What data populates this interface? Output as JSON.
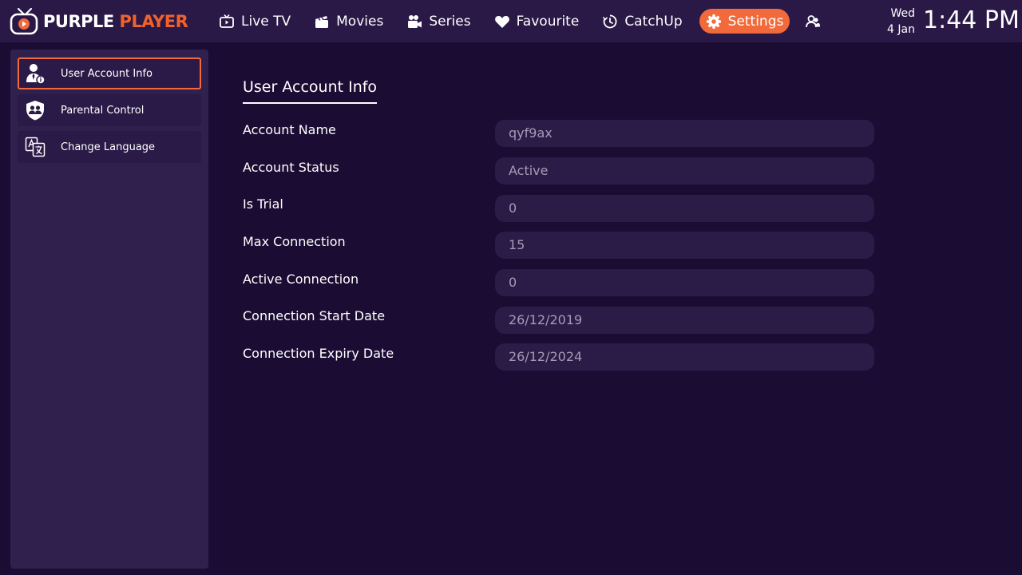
{
  "app": {
    "logo_main": "PURPLE",
    "logo_accent": "PLAYER"
  },
  "nav": {
    "items": [
      {
        "label": "Live TV",
        "icon": "tv-icon"
      },
      {
        "label": "Movies",
        "icon": "clapperboard-icon"
      },
      {
        "label": "Series",
        "icon": "video-camera-icon"
      },
      {
        "label": "Favourite",
        "icon": "heart-icon"
      },
      {
        "label": "CatchUp",
        "icon": "clock-history-icon"
      },
      {
        "label": "Settings",
        "icon": "gear-icon",
        "active": true
      }
    ],
    "profile_icon": "users-icon"
  },
  "datetime": {
    "day": "Wed",
    "date": "4 Jan",
    "time": "1:44 PM"
  },
  "sidebar": {
    "items": [
      {
        "label": "User Account Info",
        "icon": "user-info-icon",
        "active": true
      },
      {
        "label": "Parental Control",
        "icon": "shield-users-icon"
      },
      {
        "label": "Change Language",
        "icon": "translate-icon"
      }
    ]
  },
  "main": {
    "title": "User Account Info",
    "rows": [
      {
        "label": "Account Name",
        "value": "qyf9ax"
      },
      {
        "label": "Account Status",
        "value": "Active"
      },
      {
        "label": "Is Trial",
        "value": "0"
      },
      {
        "label": "Max Connection",
        "value": "15"
      },
      {
        "label": "Active Connection",
        "value": "0"
      },
      {
        "label": "Connection Start Date",
        "value": "26/12/2019"
      },
      {
        "label": "Connection Expiry Date",
        "value": "26/12/2024"
      }
    ]
  },
  "colors": {
    "background": "#1b0c33",
    "topbar": "#2a1847",
    "accent": "#f26a3b",
    "panel": "#30204e",
    "field": "#2b1c47",
    "field_text": "#a59bb8"
  }
}
